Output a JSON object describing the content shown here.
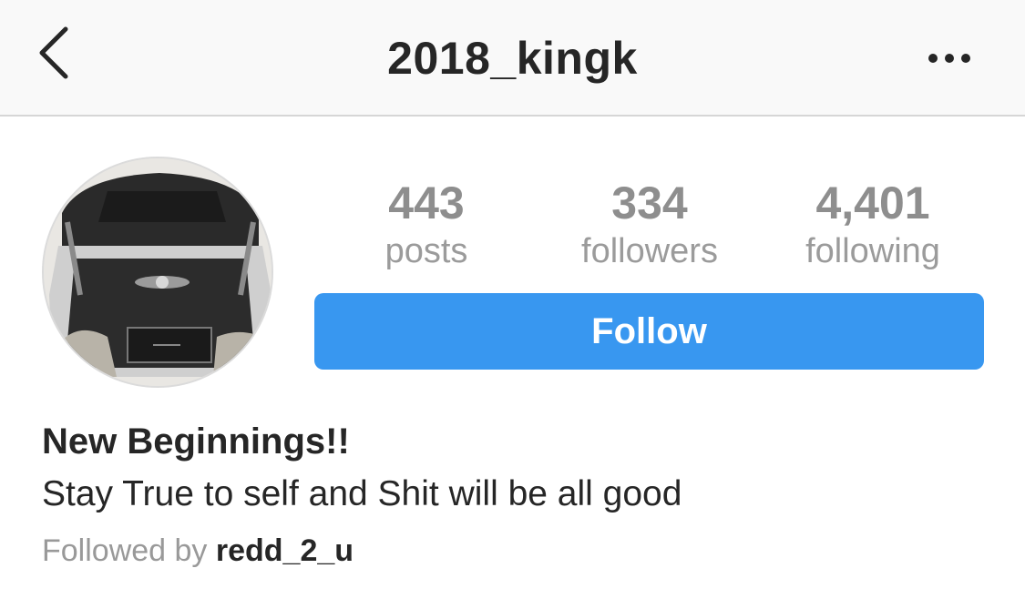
{
  "nav": {
    "title": "2018_kingk",
    "back_icon": "chevron-left-icon",
    "more_icon": "more-horizontal-icon"
  },
  "profile": {
    "avatar_icon": "profile-avatar",
    "stats": [
      {
        "number": "443",
        "label": "posts"
      },
      {
        "number": "334",
        "label": "followers"
      },
      {
        "number": "4,401",
        "label": "following"
      }
    ],
    "follow_label": "Follow",
    "accent_color": "#3897f0"
  },
  "bio": {
    "name": "New Beginnings!!",
    "text": "Stay True to self and Shit will be all good",
    "followed_by_prefix": "Followed by ",
    "followed_by_user": "redd_2_u"
  }
}
